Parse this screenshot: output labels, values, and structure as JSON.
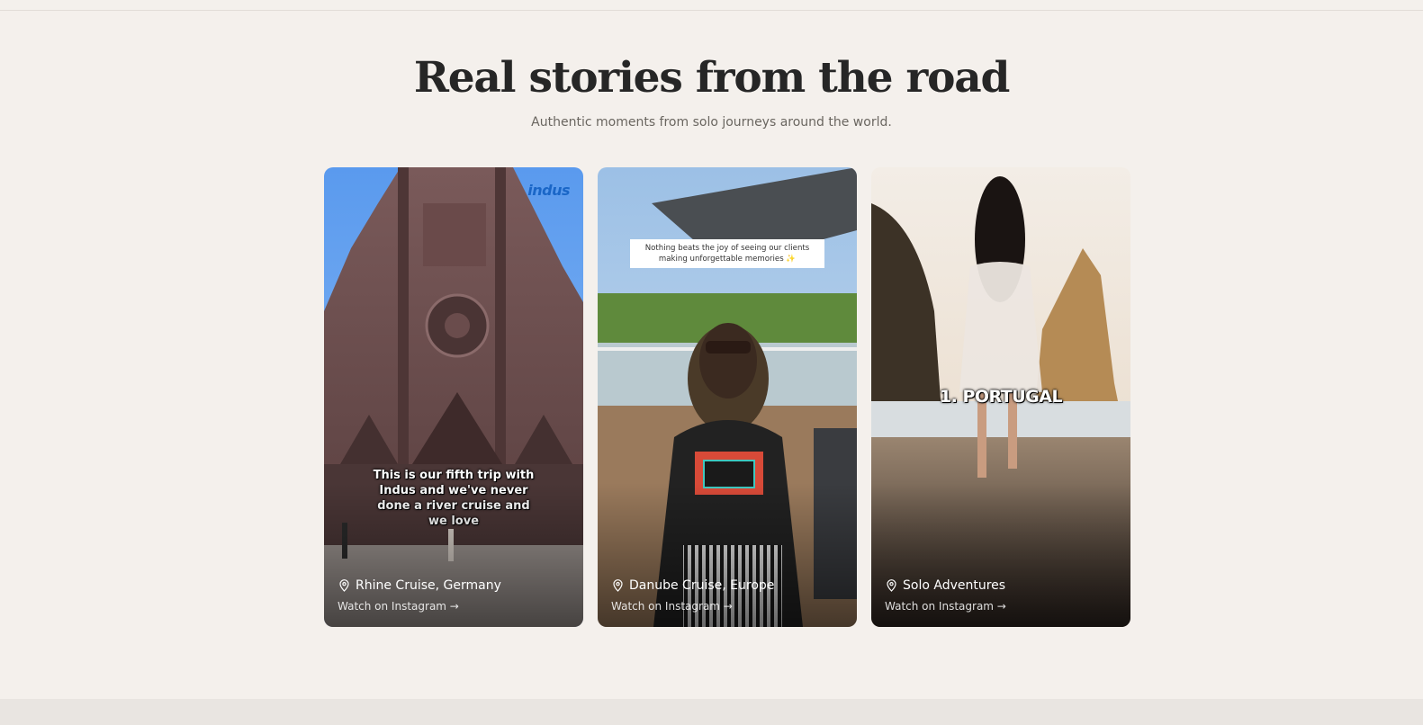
{
  "section": {
    "title": "Real stories from the road",
    "subtitle": "Authentic moments from solo journeys around the world."
  },
  "cards": [
    {
      "location": "Rhine Cruise, Germany",
      "link_label": "Watch on Instagram →",
      "caption": "This is our fifth trip with Indus and we've never done a river cruise and we love",
      "brand": "indus"
    },
    {
      "location": "Danube Cruise, Europe",
      "link_label": "Watch on Instagram →",
      "caption": "Nothing beats the joy of seeing our clients making unforgettable memories ✨"
    },
    {
      "location": "Solo Adventures",
      "link_label": "Watch on Instagram →",
      "caption": "1. PORTUGAL"
    }
  ],
  "icons": {
    "location": "map-pin-icon"
  },
  "colors": {
    "background": "#f4f0ec",
    "title": "#262626",
    "subtitle": "#6a6660"
  }
}
